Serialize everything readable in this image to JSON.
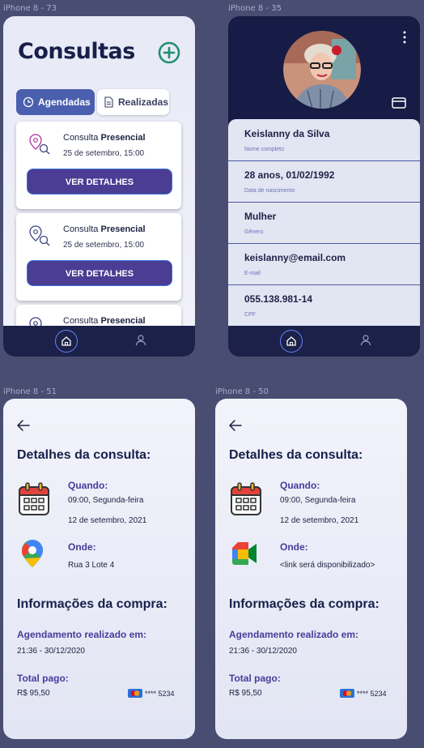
{
  "frames": {
    "f1": "iPhone 8 - 73",
    "f2": "iPhone 8 - 35",
    "f3": "iPhone 8 - 51",
    "f4": "iPhone 8 - 50"
  },
  "consultas": {
    "title": "Consultas",
    "tabs": [
      {
        "label": "Agendadas",
        "active": true
      },
      {
        "label": "Realizadas",
        "active": false
      }
    ],
    "cards": [
      {
        "prefix": "Consulta",
        "kind": "Presencial",
        "date": "25 de setembro, 15:00",
        "button": "VER DETALHES"
      },
      {
        "prefix": "Consulta",
        "kind": "Presencial",
        "date": "25 de setembro, 15:00",
        "button": "VER DETALHES"
      },
      {
        "prefix": "Consulta",
        "kind": "Presencial"
      }
    ]
  },
  "profile": {
    "fields": [
      {
        "value": "Keislanny da Silva",
        "label": "Nome completo"
      },
      {
        "value": "28 anos, 01/02/1992",
        "label": "Data de nascimento"
      },
      {
        "value": "Mulher",
        "label": "Gênero"
      },
      {
        "value": "keislanny@email.com",
        "label": "E-mail"
      },
      {
        "value": "055.138.981-14",
        "label": "CPF"
      }
    ]
  },
  "detail_presencial": {
    "title": "Detalhes da consulta:",
    "when_label": "Quando:",
    "when_time": "09:00, Segunda-feira",
    "when_date": "12 de setembro, 2021",
    "where_label": "Onde:",
    "where_value": "Rua 3 Lote 4",
    "purchase_title": "Informações da compra:",
    "scheduled_label": "Agendamento realizado em:",
    "scheduled_value": "21:36 - 30/12/2020",
    "total_label": "Total pago:",
    "total_value": "R$ 95,50",
    "card": "**** 5234"
  },
  "detail_online": {
    "title": "Detalhes da consulta:",
    "when_label": "Quando:",
    "when_time": "09:00, Segunda-feira",
    "when_date": "12 de setembro, 2021",
    "where_label": "Onde:",
    "where_value": "<link será disponibilizado>",
    "purchase_title": "Informações da compra:",
    "scheduled_label": "Agendamento realizado em:",
    "scheduled_value": "21:36 - 30/12/2020",
    "total_label": "Total pago:",
    "total_value": "R$ 95,50",
    "card": "**** 5234"
  },
  "colors": {
    "background": "#4a4d72",
    "navy": "#1b2148",
    "primary_button": "#4b3d94",
    "tab_active": "#4a5fae",
    "accent_label": "#4a3a9c"
  },
  "icons": [
    "add-circle-icon",
    "clock-icon",
    "document-icon",
    "location-search-icon",
    "home-icon",
    "user-icon",
    "more-vertical-icon",
    "credit-card-icon",
    "arrow-left-icon",
    "calendar-icon",
    "google-maps-icon",
    "google-meet-icon",
    "mastercard-icon"
  ]
}
